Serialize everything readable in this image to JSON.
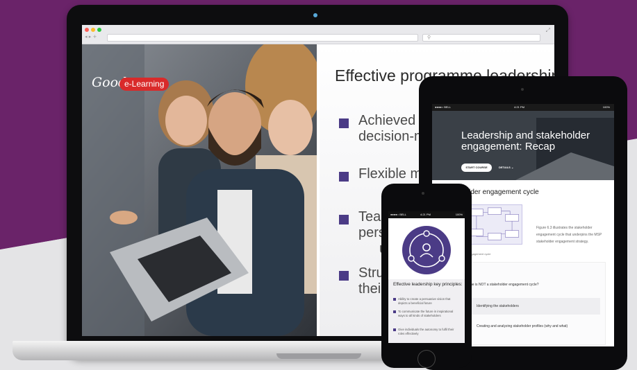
{
  "colors": {
    "background": "#6a2369",
    "accent": "#4b3b86",
    "brand_badge": "#d92a2a"
  },
  "browser": {
    "nav": "◂ ▸ +",
    "search_placeholder": "⚲",
    "expand": "⤢"
  },
  "brand": {
    "script": "Good",
    "badge": "e-Learning"
  },
  "slide": {
    "title": "Effective programme leadership",
    "bullets": [
      {
        "lines": [
          "Achieved t",
          "decision-m"
        ]
      },
      {
        "lines": [
          "Flexible m"
        ]
      },
      {
        "lines": [
          "Tea",
          "pers",
          "u"
        ]
      },
      {
        "lines": [
          "Stru",
          "thei"
        ]
      }
    ]
  },
  "tablet": {
    "status_left": "●●●●○ BELL",
    "status_time": "4:21 PM",
    "status_right": "100%",
    "hero_title": "Leadership and stakeholder engagement: Recap",
    "start_button": "START COURSE",
    "details_link": "DETAILS",
    "section_title": "holder engagement cycle",
    "figure_caption": "Figure 6.3 illustrates the stakeholder engagement cycle that underpins the MSP stakeholder engagement strategy.",
    "figure_label": "engagement cycle",
    "question": "he is NOT a stakeholder engagement cycle?",
    "options": [
      "Identifying the stakeholders",
      "Creating and analyzing stakeholder profiles (why and what)"
    ]
  },
  "phone": {
    "status_left": "●●●●○ BELL",
    "status_time": "4:21 PM",
    "status_right": "100%",
    "heading": "Effective leadership key principles:",
    "items": [
      "Ability to create a persuasive vision that depicts a beneficial future",
      "To communicate the future in inspirational ways to all kinds of stakeholders",
      "Give individuals the autonomy to fulfil their roles effectively"
    ]
  },
  "icons": [
    "laptop-camera-icon",
    "stakeholder-network-icon",
    "phone-home-button-icon",
    "expand-icon"
  ]
}
